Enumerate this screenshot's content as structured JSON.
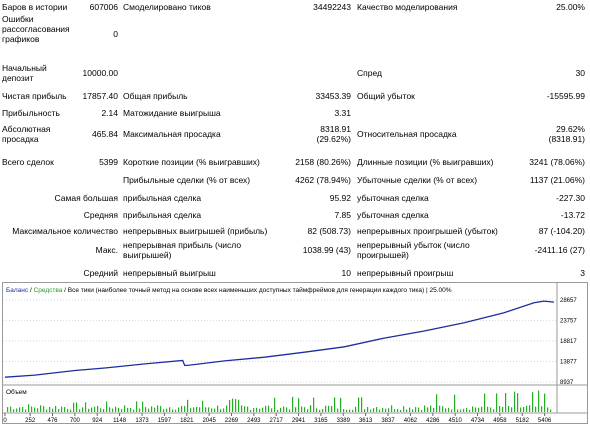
{
  "stats": {
    "bars_label": "Баров в истории",
    "bars_value": "607006",
    "ticks_label": "Смоделировано тиков",
    "ticks_value": "34492243",
    "quality_label": "Качество моделирования",
    "quality_value": "25.00%",
    "mismatch_label": "Ошибки рассогласования графиков",
    "mismatch_value": "0",
    "deposit_label": "Начальный депозит",
    "deposit_value": "10000.00",
    "spread_label": "Спред",
    "spread_value": "30",
    "net_label": "Чистая прибыль",
    "net_value": "17857.40",
    "gross_profit_label": "Общая прибыль",
    "gross_profit_value": "33453.39",
    "gross_loss_label": "Общий убыток",
    "gross_loss_value": "-15595.99",
    "pf_label": "Прибыльность",
    "pf_value": "2.14",
    "payoff_label": "Матожидание выигрыша",
    "payoff_value": "3.31",
    "abs_dd_label": "Абсолютная просадка",
    "abs_dd_value": "465.84",
    "max_dd_label": "Максимальная просадка",
    "max_dd_value": "8318.91",
    "max_dd_pct": "(29.62%)",
    "rel_dd_label": "Относительная просадка",
    "rel_dd_value": "29.62%",
    "rel_dd_abs": "(8318.91)",
    "total_label": "Всего сделок",
    "total_value": "5399",
    "short_label": "Короткие позиции (% выигравших)",
    "short_value": "2158 (80.26%)",
    "long_label": "Длинные позиции (% выигравших)",
    "long_value": "3241 (78.06%)",
    "profit_trades_label": "Прибыльные сделки (% от всех)",
    "profit_trades_value": "4262 (78.94%)",
    "loss_trades_label": "Убыточные сделки (% от всех)",
    "loss_trades_value": "1137 (21.06%)",
    "largest_label": "Самая большая",
    "largest_profit_label": "прибыльная сделка",
    "largest_profit_value": "95.92",
    "largest_loss_label": "убыточная сделка",
    "largest_loss_value": "-227.30",
    "average_label": "Средняя",
    "avg_profit_label": "прибыльная сделка",
    "avg_profit_value": "7.85",
    "avg_loss_label": "убыточная сделка",
    "avg_loss_value": "-13.72",
    "max_count_label": "Максимальное количество",
    "max_cons_wins_label": "непрерывных выигрышей (прибыль)",
    "max_cons_wins_value": "82 (508.73)",
    "max_cons_losses_label": "непрерывных проигрышей (убыток)",
    "max_cons_losses_value": "87 (-104.20)",
    "max_label": "Макс.",
    "max_cons_profit_label": "непрерывная прибыль (число выигрышей)",
    "max_cons_profit_value": "1038.99 (43)",
    "max_cons_loss_label": "непрерывный убыток (число проигрышей)",
    "max_cons_loss_value": "-2411.16 (27)",
    "avg_label": "Средний",
    "avg_cons_wins_label": "непрерывный выигрыш",
    "avg_cons_wins_value": "10",
    "avg_cons_losses_label": "непрерывный проигрыш",
    "avg_cons_losses_value": "3"
  },
  "chart": {
    "legend_balance": "Баланс",
    "legend_sep1": " / ",
    "legend_equity": "Средства",
    "legend_rest": " / Все тики (наиболее точный метод на основе всех наименьших доступных таймфреймов для генерации каждого тика) | 25.00%",
    "volume_label": "Объем",
    "colors": {
      "balance": "#1c2f9c",
      "equity": "#2a9b2a",
      "volume": "#22b022",
      "grid": "#d8d8d8"
    }
  },
  "chart_data": {
    "type": "line",
    "yticks": [
      "28657",
      "23757",
      "18817",
      "13877",
      "8937"
    ],
    "ylim": [
      8937,
      28657
    ],
    "xticks": [
      "0",
      "252",
      "476",
      "700",
      "924",
      "1148",
      "1373",
      "1597",
      "1821",
      "2045",
      "2269",
      "2493",
      "2717",
      "2941",
      "3165",
      "3389",
      "3613",
      "3837",
      "4062",
      "4286",
      "4510",
      "4734",
      "4958",
      "5182",
      "5406"
    ],
    "xlim": [
      0,
      5500
    ],
    "series": [
      {
        "name": "Баланс",
        "x": [
          0,
          300,
          700,
          1000,
          1400,
          1780,
          1800,
          1850,
          2200,
          2600,
          3000,
          3400,
          3800,
          4200,
          4600,
          5000,
          5300,
          5400,
          5500
        ],
        "values": [
          10100,
          10600,
          11700,
          12300,
          13300,
          14100,
          12900,
          13000,
          14000,
          14900,
          16100,
          17400,
          19500,
          21200,
          23200,
          25600,
          28000,
          28400,
          28150
        ]
      }
    ]
  }
}
